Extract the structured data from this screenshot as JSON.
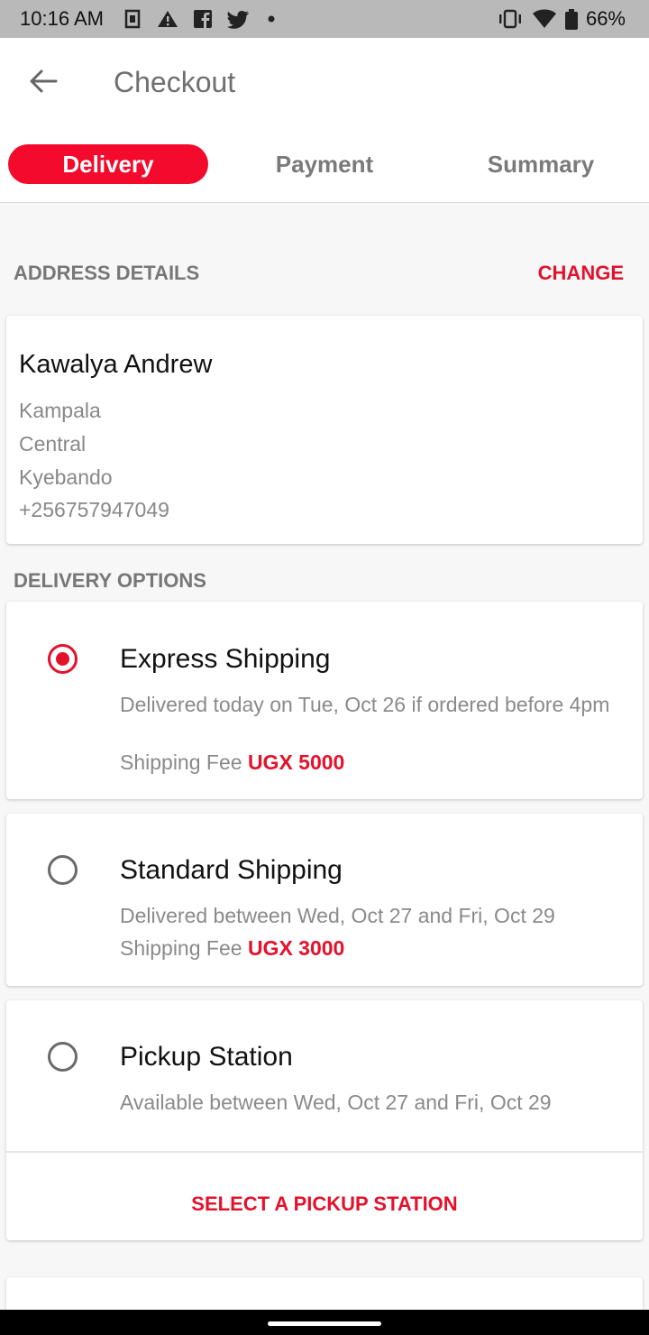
{
  "status_bar": {
    "time": "10:16 AM",
    "battery": "66%",
    "left_icons": [
      "sim-icon",
      "alert-icon",
      "facebook-icon",
      "twitter-icon",
      "dot-icon"
    ],
    "right_icons": [
      "vibrate-icon",
      "wifi-icon",
      "battery-icon"
    ]
  },
  "header": {
    "title": "Checkout"
  },
  "tabs": [
    {
      "label": "Delivery",
      "active": true
    },
    {
      "label": "Payment",
      "active": false
    },
    {
      "label": "Summary",
      "active": false
    }
  ],
  "address": {
    "section_title": "ADDRESS DETAILS",
    "change_label": "CHANGE",
    "name": "Kawalya Andrew",
    "lines": [
      "Kampala",
      "Central",
      "Kyebando",
      "+256757947049"
    ]
  },
  "delivery": {
    "section_title": "DELIVERY OPTIONS",
    "options": [
      {
        "title": "Express Shipping",
        "description": "Delivered today on Tue, Oct 26 if ordered before 4pm",
        "fee_label": "Shipping Fee",
        "fee_value": "UGX 5000",
        "selected": true
      },
      {
        "title": "Standard Shipping",
        "description": "Delivered between Wed, Oct 27 and Fri, Oct 29",
        "fee_label": "Shipping Fee",
        "fee_value": "UGX 3000",
        "selected": false
      },
      {
        "title": "Pickup Station",
        "description": "Available between Wed, Oct 27 and Fri, Oct 29",
        "selected": false,
        "action_label": "SELECT A PICKUP STATION"
      }
    ]
  },
  "colors": {
    "accent": "#e4112b",
    "tab_active_bg": "#f40a2c"
  }
}
